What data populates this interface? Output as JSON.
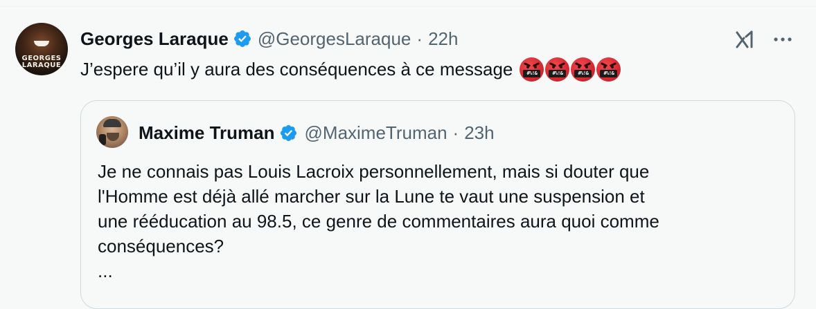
{
  "post": {
    "author": {
      "display_name": "Georges Laraque",
      "handle": "@GeorgesLaraque",
      "verified": true,
      "avatar_text_line1": "GEORGES",
      "avatar_text_line2": "LARAQUE"
    },
    "separator": "·",
    "time": "22h",
    "text": "J’espere qu’il y aura des conséquences à ce message",
    "emoji_label": "#%!&",
    "emoji_count": 4,
    "emoji_name": "face-with-symbols-on-mouth"
  },
  "icons": {
    "grok": "grok-icon",
    "more": "more-icon",
    "verified": "verified-badge-icon"
  },
  "quoted_post": {
    "author": {
      "display_name": "Maxime Truman",
      "handle": "@MaximeTruman",
      "verified": true
    },
    "separator": "·",
    "time": "23h",
    "lines": [
      "Je ne connais pas Louis Lacroix personnellement, mais si douter que",
      "l'Homme est déjà allé marcher sur la Lune te vaut une suspension et",
      "une rééducation au 98.5, ce genre de commentaires aura quoi comme",
      "conséquences?"
    ],
    "truncation": "..."
  },
  "colors": {
    "background": "#f7f9f9",
    "text_primary": "#0f1419",
    "text_secondary": "#536471",
    "verified_blue": "#1d9bf0",
    "border": "#cfd9de",
    "emoji_red": "#d72b34"
  }
}
